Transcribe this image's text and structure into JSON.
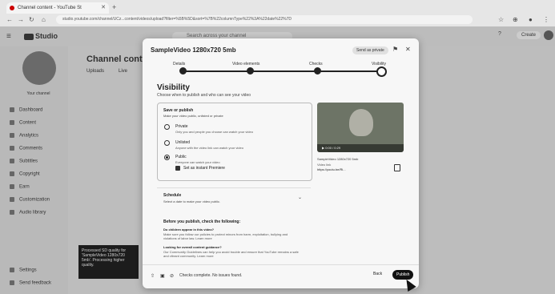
{
  "browser": {
    "tab_title": "Channel content - YouTube St",
    "url": "studio.youtube.com/channel/UCz...content/videos/upload?filter=%5B%5D&sort=%7B%22columnType%22%3A%22date%22%7D"
  },
  "header": {
    "logo": "Studio",
    "search_placeholder": "Search across your channel",
    "create_label": "Create"
  },
  "sidebar": {
    "channel_name": "Your channel",
    "items": [
      {
        "label": "Dashboard",
        "icon": "dashboard-icon"
      },
      {
        "label": "Content",
        "icon": "content-icon"
      },
      {
        "label": "Analytics",
        "icon": "analytics-icon"
      },
      {
        "label": "Comments",
        "icon": "comments-icon"
      },
      {
        "label": "Subtitles",
        "icon": "subtitles-icon"
      },
      {
        "label": "Copyright",
        "icon": "copyright-icon"
      },
      {
        "label": "Earn",
        "icon": "earn-icon"
      },
      {
        "label": "Customization",
        "icon": "customization-icon"
      },
      {
        "label": "Audio library",
        "icon": "audio-icon"
      },
      {
        "label": "Settings",
        "icon": "settings-icon"
      },
      {
        "label": "Send feedback",
        "icon": "feedback-icon"
      }
    ]
  },
  "page": {
    "title": "Channel content",
    "tabs": [
      "Uploads",
      "Live"
    ]
  },
  "toast": {
    "text": "Processed SD quality for 'SampleVideo 1280x720 5mb'. Processing higher quality."
  },
  "modal": {
    "title": "SampleVideo 1280x720 5mb",
    "send_admin": "Send as private",
    "steps": [
      {
        "label": "Details"
      },
      {
        "label": "Video elements"
      },
      {
        "label": "Checks"
      },
      {
        "label": "Visibility"
      }
    ],
    "visibility_title": "Visibility",
    "visibility_sub": "Choose when to publish and who can see your video",
    "save_publish": {
      "title": "Save or publish",
      "subtitle": "Make your video public, unlisted or private",
      "options": [
        {
          "label": "Private",
          "desc": "Only you and people you choose can watch your video"
        },
        {
          "label": "Unlisted",
          "desc": "Anyone with the video link can watch your video"
        },
        {
          "label": "Public",
          "desc": "Everyone can watch your video"
        }
      ],
      "selected": "Public",
      "premiere_label": "Set as instant Premiere"
    },
    "video": {
      "time": "0:00 / 0:29",
      "filename": "SampleVideo 1280x720 5mb",
      "link_label": "Video link",
      "link": "https://youtu.be/Ri..."
    },
    "schedule": {
      "title": "Schedule",
      "subtitle": "Select a date to make your video public."
    },
    "before_title": "Before you publish, check the following:",
    "checks": [
      {
        "q": "Do children appear in this video?",
        "d": "Make sure you follow our policies to protect minors from harm, exploitation, bullying and violations of labor law. Learn more"
      },
      {
        "q": "Looking for overall content guidance?",
        "d": "Our Community Guidelines can help you avoid trouble and ensure that YouTube remains a safe and vibrant community. Learn more"
      }
    ],
    "footer_status": "Checks complete. No issues found.",
    "back_label": "Back",
    "publish_label": "Publish"
  }
}
